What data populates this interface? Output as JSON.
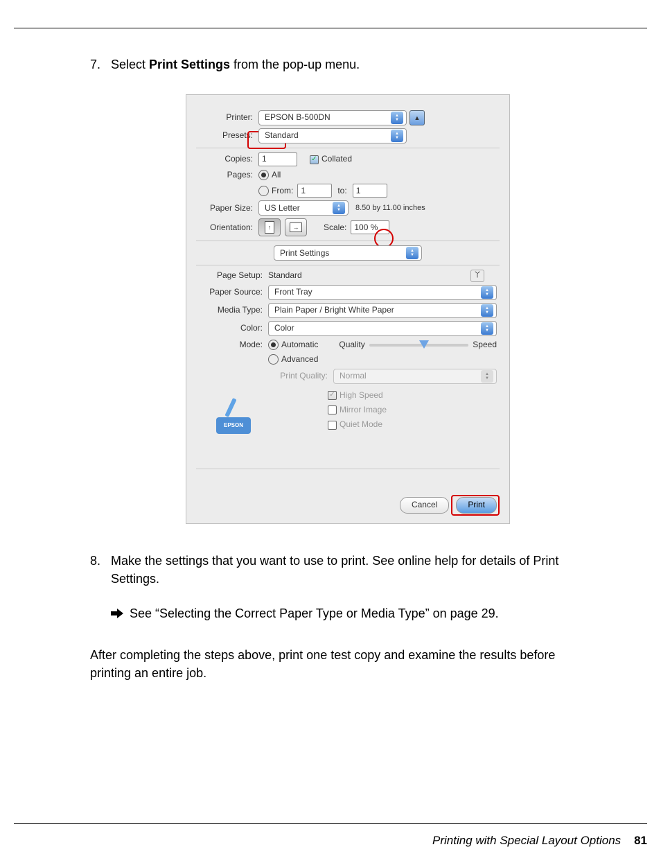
{
  "step7": {
    "num": "7.",
    "pre": "Select ",
    "bold": "Print Settings",
    "post": " from the pop-up menu."
  },
  "dialog": {
    "printer_lbl": "Printer:",
    "printer_val": "EPSON B-500DN",
    "presets_lbl": "Presets:",
    "presets_val": "Standard",
    "copies_lbl": "Copies:",
    "copies_val": "1",
    "collated_lbl": "Collated",
    "pages_lbl": "Pages:",
    "pages_all": "All",
    "pages_from": "From:",
    "pages_from_val": "1",
    "pages_to": "to:",
    "pages_to_val": "1",
    "papersize_lbl": "Paper Size:",
    "papersize_val": "US Letter",
    "papersize_dim": "8.50 by 11.00 inches",
    "orient_lbl": "Orientation:",
    "scale_lbl": "Scale:",
    "scale_val": "100 %",
    "section_val": "Print Settings",
    "ps_pagesetup_lbl": "Page Setup:",
    "ps_pagesetup_val": "Standard",
    "ps_source_lbl": "Paper Source:",
    "ps_source_val": "Front Tray",
    "ps_media_lbl": "Media Type:",
    "ps_media_val": "Plain Paper / Bright White Paper",
    "ps_color_lbl": "Color:",
    "ps_color_val": "Color",
    "ps_mode_lbl": "Mode:",
    "ps_mode_auto": "Automatic",
    "ps_mode_adv": "Advanced",
    "ps_quality_left": "Quality",
    "ps_quality_right": "Speed",
    "ps_pq_lbl": "Print Quality:",
    "ps_pq_val": "Normal",
    "ps_hs": "High Speed",
    "ps_mi": "Mirror Image",
    "ps_qm": "Quiet Mode",
    "epson": "EPSON",
    "cancel": "Cancel",
    "print": "Print"
  },
  "step8": {
    "num": "8.",
    "text": "Make the settings that you want to use to print. See online help for details of Print Settings."
  },
  "see_ref": "See “Selecting the Correct Paper Type or Media Type” on page 29.",
  "closing": "After completing the steps above, print one test copy and examine the results before printing an entire job.",
  "footer_text": "Printing with Special Layout Options",
  "footer_page": "81"
}
